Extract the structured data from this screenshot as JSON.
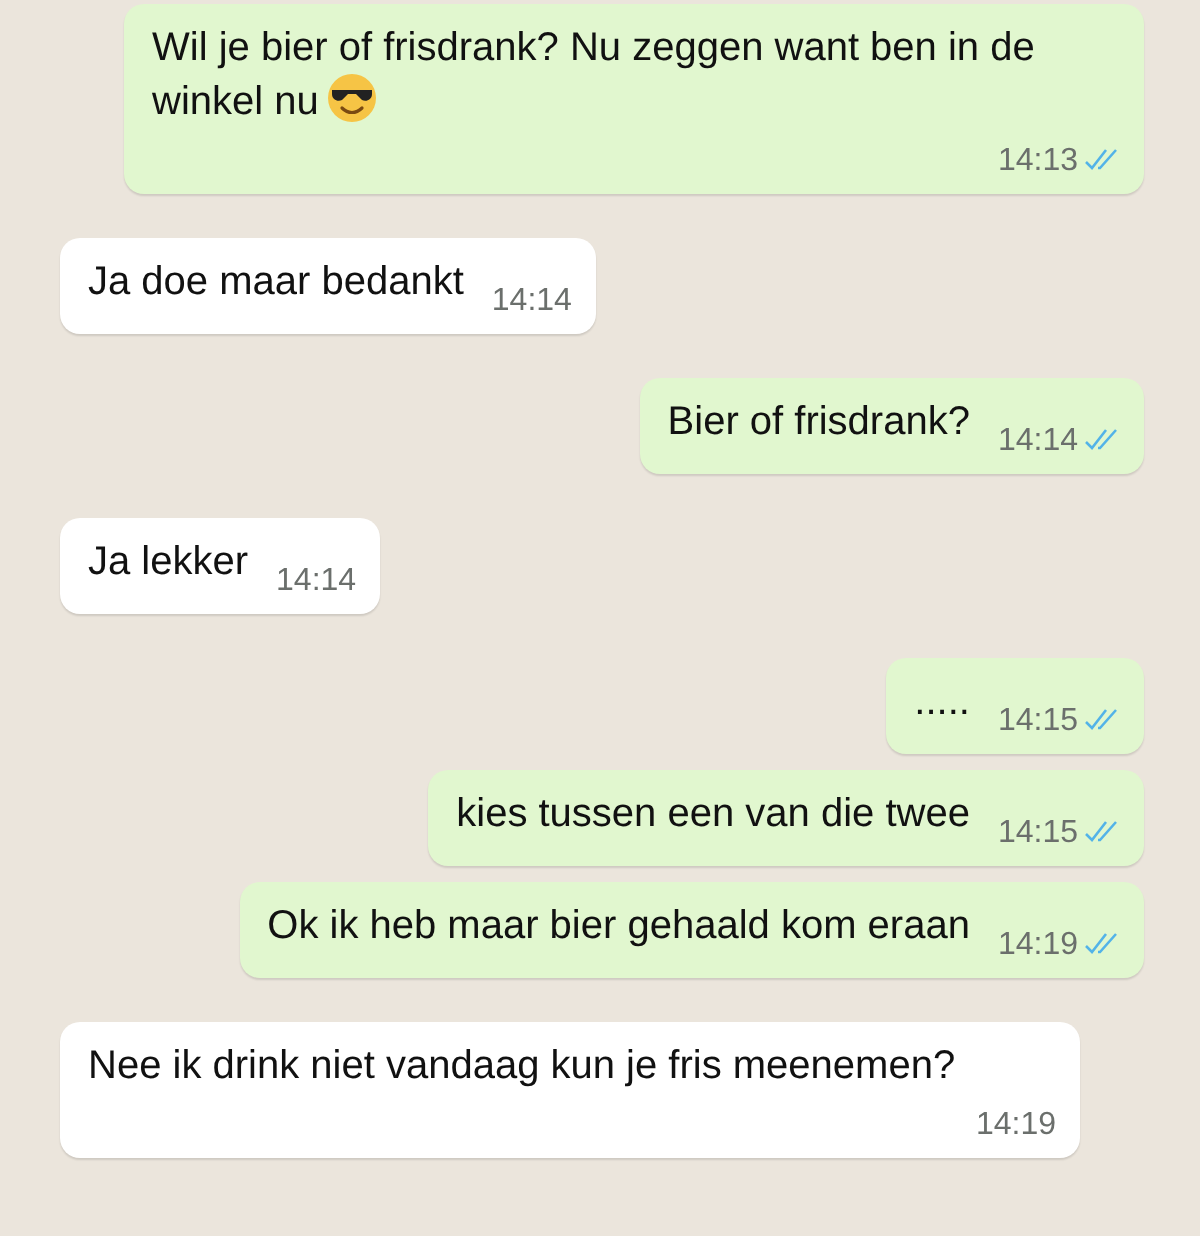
{
  "messages": [
    {
      "kind": "sent",
      "text": "Wil je bier of frisdrank? Nu zeggen want ben in de winkel nu",
      "emoji": true,
      "time": "14:13",
      "read": true
    },
    {
      "kind": "received",
      "text": "Ja doe maar bedankt",
      "time": "14:14"
    },
    {
      "kind": "sent",
      "text": "Bier of frisdrank?",
      "time": "14:14",
      "read": true
    },
    {
      "kind": "received",
      "text": "Ja lekker",
      "time": "14:14"
    },
    {
      "kind": "sent",
      "text": ".....",
      "time": "14:15",
      "read": true
    },
    {
      "kind": "sent",
      "text": "kies tussen een van die twee",
      "time": "14:15",
      "read": true
    },
    {
      "kind": "sent",
      "text": "Ok ik heb maar bier gehaald kom eraan",
      "time": "14:19",
      "read": true
    },
    {
      "kind": "received",
      "text": "Nee ik drink niet vandaag kun je fris meenemen?",
      "time": "14:19"
    }
  ]
}
